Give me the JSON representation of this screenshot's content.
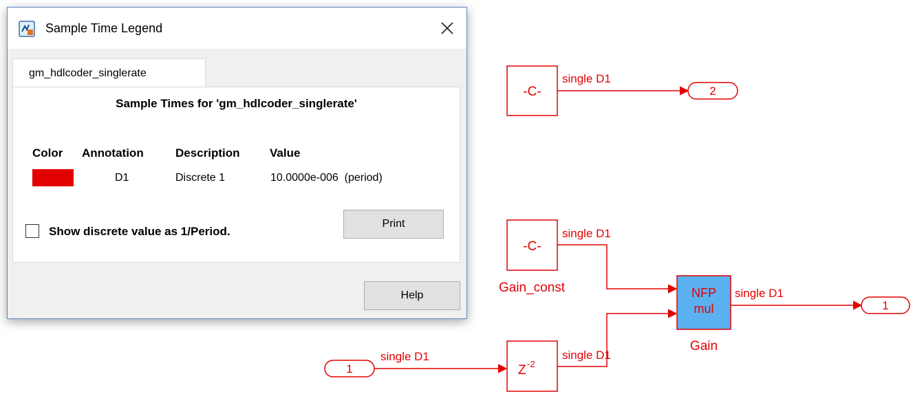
{
  "dialog": {
    "title": "Sample Time Legend",
    "tab_label": "gm_hdlcoder_singlerate",
    "panel_title": "Sample Times for 'gm_hdlcoder_singlerate'",
    "columns": [
      "Color",
      "Annotation",
      "Description",
      "Value"
    ],
    "row": {
      "color": "#e30000",
      "annotation": "D1",
      "description": "Discrete 1",
      "value": "10.0000e-006  (period)"
    },
    "checkbox_label": "Show discrete value as 1/Period.",
    "checkbox_checked": false,
    "print_label": "Print",
    "help_label": "Help"
  },
  "diagram": {
    "signal_color": "#e30000",
    "gain_fill_color": "#5bb0f0",
    "const_top_label": "-C-",
    "const_gain_label": "-C-",
    "gain_const_name": "Gain_const",
    "outport_top_label": "2",
    "outport_right_label": "1",
    "inport_label": "1",
    "gain_block_line1": "NFP",
    "gain_block_line2": "mul",
    "gain_name": "Gain",
    "delay_base": "Z",
    "delay_exponent": "-2",
    "signal_labels": {
      "const_top_out": "single D1",
      "const_gain_out": "single D1",
      "gain_out": "single D1",
      "inport_out": "single D1",
      "delay_out": "single D1"
    }
  }
}
